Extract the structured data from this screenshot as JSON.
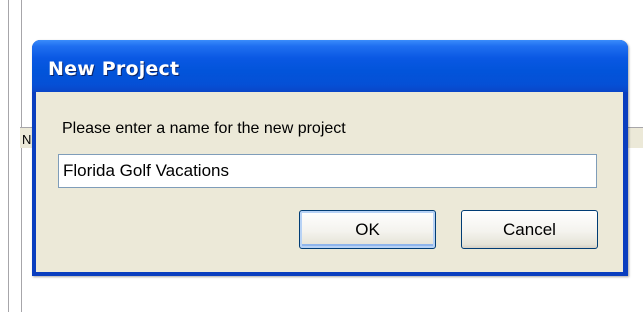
{
  "dialog": {
    "title": "New Project",
    "prompt": "Please enter a name for the new project",
    "input_value": "Florida Golf Vacations",
    "ok_label": "OK",
    "cancel_label": "Cancel"
  },
  "background": {
    "partial_letter": "N"
  },
  "colors": {
    "titlebar": "#0254da",
    "dialog_face": "#ece9d8",
    "input_border": "#7f9db9",
    "button_border": "#003c74"
  }
}
